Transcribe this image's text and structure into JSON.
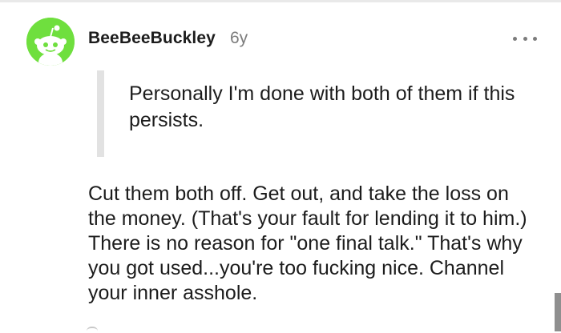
{
  "comment": {
    "author": "BeeBeeBuckley",
    "age": "6y",
    "quote": "Personally I'm done with both of them if this persists.",
    "body": "Cut them both off. Get out, and take the loss on the money. (That's your fault for lending it to him.) There is no reason for \"one final talk.\" That's why you got used...you're too fucking nice. Channel your inner asshole.",
    "avatar_icon": "reddit-snoo-avatar",
    "more_icon": "more-options-icon"
  },
  "colors": {
    "avatar_bg": "#6fdf3e",
    "text": "#1c1c1c",
    "muted": "#7c7c7c",
    "quote_bar": "#e2e2e2"
  }
}
